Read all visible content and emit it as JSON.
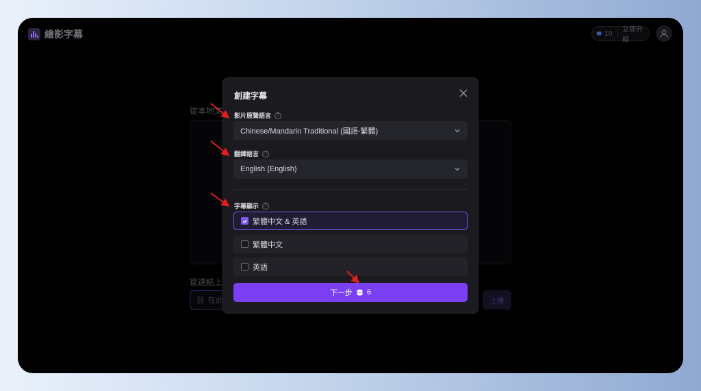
{
  "app": {
    "title": "繪影字幕"
  },
  "header": {
    "credits_count": "10",
    "upgrade_label": "立即升級"
  },
  "background": {
    "local_upload_label": "從本地文",
    "url_upload_label": "從連結上",
    "url_input_placeholder": "在此",
    "upload_button_label": "上傳"
  },
  "modal": {
    "title": "創建字幕",
    "source_language": {
      "label": "影片原聲語言",
      "help": "?",
      "value": "Chinese/Mandarin Traditional (國語-繁體)"
    },
    "translation_language": {
      "label": "翻譯語言",
      "help": "?",
      "value": "English (English)"
    },
    "subtitle_display": {
      "label": "字幕顯示",
      "help": "?",
      "options": [
        {
          "label": "繁體中文 & 英語",
          "checked": true
        },
        {
          "label": "繁體中文",
          "checked": false
        },
        {
          "label": "英語",
          "checked": false
        }
      ]
    },
    "next_button": {
      "label": "下一步",
      "cost": "6"
    }
  },
  "colors": {
    "accent": "#7b3ff2",
    "annotation_arrow": "#e0201e"
  }
}
